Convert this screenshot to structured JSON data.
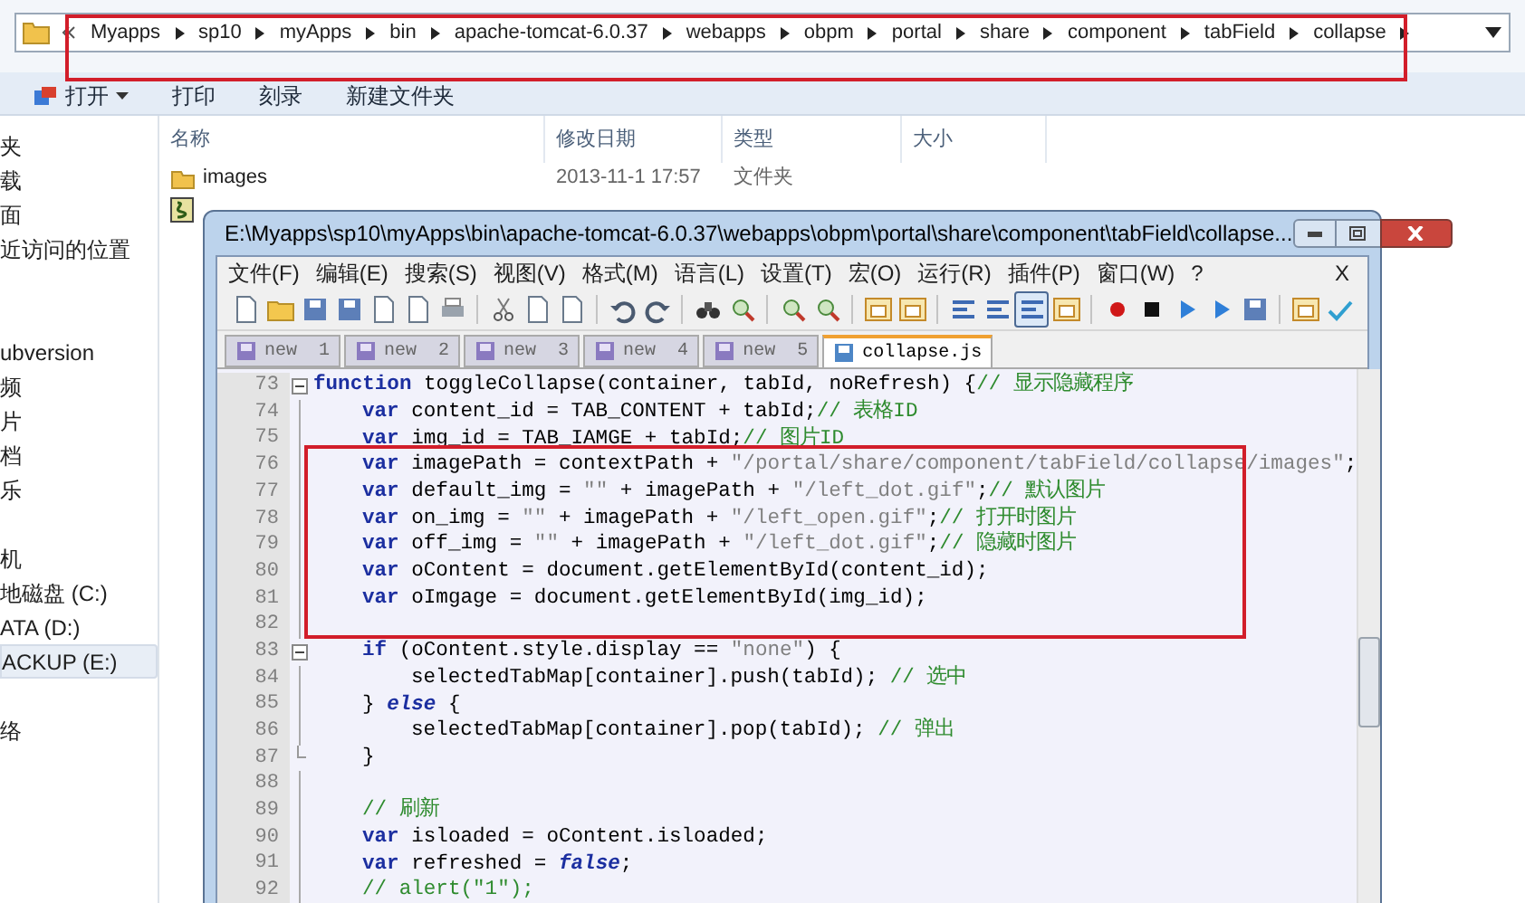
{
  "explorer": {
    "breadcrumb": [
      "Myapps",
      "sp10",
      "myApps",
      "bin",
      "apache-tomcat-6.0.37",
      "webapps",
      "obpm",
      "portal",
      "share",
      "component",
      "tabField",
      "collapse"
    ],
    "toolbar": [
      {
        "label": "打开",
        "dropdown": true
      },
      {
        "label": "打印",
        "dropdown": false
      },
      {
        "label": "刻录",
        "dropdown": false
      },
      {
        "label": "新建文件夹",
        "dropdown": false
      }
    ],
    "nav": [
      [
        {
          "label": "夹",
          "selected": false
        },
        {
          "label": "载",
          "selected": false
        },
        {
          "label": "面",
          "selected": false
        },
        {
          "label": "近访问的位置",
          "selected": false
        }
      ],
      [
        {
          "label": "ubversion",
          "selected": false
        },
        {
          "label": "频",
          "selected": false
        },
        {
          "label": "片",
          "selected": false
        },
        {
          "label": "档",
          "selected": false
        },
        {
          "label": "乐",
          "selected": false
        }
      ],
      [
        {
          "label": "机",
          "selected": false
        },
        {
          "label": "地磁盘 (C:)",
          "selected": false
        },
        {
          "label": "ATA (D:)",
          "selected": false
        },
        {
          "label": "ACKUP (E:)",
          "selected": true
        }
      ],
      [
        {
          "label": "络",
          "selected": false
        }
      ]
    ],
    "columns": [
      "名称",
      "修改日期",
      "类型",
      "大小"
    ],
    "rows": [
      {
        "kind": "folder",
        "name": "images",
        "date": "2013-11-1 17:57",
        "type": "文件夹"
      },
      {
        "kind": "script"
      }
    ]
  },
  "editor": {
    "title": "E:\\Myapps\\sp10\\myApps\\bin\\apache-tomcat-6.0.37\\webapps\\obpm\\portal\\share\\component\\tabField\\collapse...",
    "menu": [
      "文件(F)",
      "编辑(E)",
      "搜索(S)",
      "视图(V)",
      "格式(M)",
      "语言(L)",
      "设置(T)",
      "宏(O)",
      "运行(R)",
      "插件(P)",
      "窗口(W)",
      "?"
    ],
    "close_doc": "X",
    "toolbar": [
      [
        {
          "pressed": false
        },
        {
          "pressed": false
        },
        {
          "pressed": false
        },
        {
          "pressed": false
        },
        {
          "pressed": false
        },
        {
          "pressed": false
        },
        {
          "pressed": false
        }
      ],
      [
        {
          "pressed": false
        },
        {
          "pressed": false
        },
        {
          "pressed": false
        }
      ],
      [
        {
          "pressed": false
        },
        {
          "pressed": false
        }
      ],
      [
        {
          "pressed": false
        },
        {
          "pressed": false
        }
      ],
      [
        {
          "pressed": false
        },
        {
          "pressed": false
        }
      ],
      [
        {
          "pressed": false
        },
        {
          "pressed": false
        }
      ],
      [
        {
          "pressed": false
        },
        {
          "pressed": false
        },
        {
          "pressed": true
        },
        {
          "pressed": false
        }
      ],
      [
        {
          "pressed": false
        },
        {
          "pressed": false
        },
        {
          "pressed": false
        },
        {
          "pressed": false
        },
        {
          "pressed": false
        }
      ],
      [
        {
          "pressed": false
        },
        {
          "pressed": false
        }
      ]
    ],
    "tabs": [
      {
        "label": "new  1",
        "selected": false
      },
      {
        "label": "new  2",
        "selected": false
      },
      {
        "label": "new  3",
        "selected": false
      },
      {
        "label": "new  4",
        "selected": false
      },
      {
        "label": "new  5",
        "selected": false
      },
      {
        "label": "collapse.js",
        "selected": true
      }
    ],
    "lines": [
      {
        "number": "73",
        "kind": "top",
        "fold_start": true,
        "tokens": [
          {
            "kind": "kw",
            "text": "function"
          },
          {
            "kind": "plain",
            "text": " toggleCollapse(container, tabId, noRefresh) {"
          },
          {
            "kind": "comment",
            "text": "// 显示隐藏程序"
          }
        ]
      },
      {
        "number": "74",
        "kind": "body",
        "tokens": [
          {
            "kind": "kw",
            "text": "var"
          },
          {
            "kind": "plain",
            "text": " content_id = TAB_CONTENT + tabId;"
          },
          {
            "kind": "comment",
            "text": "// 表格ID"
          }
        ]
      },
      {
        "number": "75",
        "kind": "body",
        "tokens": [
          {
            "kind": "kw",
            "text": "var"
          },
          {
            "kind": "plain",
            "text": " img_id = TAB_IAMGE + tabId;"
          },
          {
            "kind": "comment",
            "text": "// 图片ID"
          }
        ]
      },
      {
        "number": "76",
        "kind": "body",
        "tokens": [
          {
            "kind": "kw",
            "text": "var"
          },
          {
            "kind": "plain",
            "text": " imagePath = contextPath + "
          },
          {
            "kind": "str",
            "text": "\"/portal/share/component/tabField/collapse/images\""
          },
          {
            "kind": "plain",
            "text": ";"
          }
        ]
      },
      {
        "number": "77",
        "kind": "body",
        "tokens": [
          {
            "kind": "kw",
            "text": "var"
          },
          {
            "kind": "plain",
            "text": " default_img = "
          },
          {
            "kind": "str",
            "text": "\"\""
          },
          {
            "kind": "plain",
            "text": " + imagePath + "
          },
          {
            "kind": "str",
            "text": "\"/left_dot.gif\""
          },
          {
            "kind": "plain",
            "text": ";"
          },
          {
            "kind": "comment",
            "text": "// 默认图片"
          }
        ]
      },
      {
        "number": "78",
        "kind": "body",
        "tokens": [
          {
            "kind": "kw",
            "text": "var"
          },
          {
            "kind": "plain",
            "text": " on_img = "
          },
          {
            "kind": "str",
            "text": "\"\""
          },
          {
            "kind": "plain",
            "text": " + imagePath + "
          },
          {
            "kind": "str",
            "text": "\"/left_open.gif\""
          },
          {
            "kind": "plain",
            "text": ";"
          },
          {
            "kind": "comment",
            "text": "// 打开时图片"
          }
        ]
      },
      {
        "number": "79",
        "kind": "body",
        "tokens": [
          {
            "kind": "kw",
            "text": "var"
          },
          {
            "kind": "plain",
            "text": " off_img = "
          },
          {
            "kind": "str",
            "text": "\"\""
          },
          {
            "kind": "plain",
            "text": " + imagePath + "
          },
          {
            "kind": "str",
            "text": "\"/left_dot.gif\""
          },
          {
            "kind": "plain",
            "text": ";"
          },
          {
            "kind": "comment",
            "text": "// 隐藏时图片"
          }
        ]
      },
      {
        "number": "80",
        "kind": "body",
        "tokens": [
          {
            "kind": "kw",
            "text": "var"
          },
          {
            "kind": "plain",
            "text": " oContent = document.getElementById(content_id);"
          }
        ]
      },
      {
        "number": "81",
        "kind": "body",
        "tokens": [
          {
            "kind": "kw",
            "text": "var"
          },
          {
            "kind": "plain",
            "text": " oImgage = document.getElementById(img_id);"
          }
        ]
      },
      {
        "number": "82"
      },
      {
        "number": "83",
        "kind": "body",
        "fold_start": true,
        "tokens": [
          {
            "kind": "kw",
            "text": "if"
          },
          {
            "kind": "plain",
            "text": " (oContent.style.display == "
          },
          {
            "kind": "str",
            "text": "\"none\""
          },
          {
            "kind": "plain",
            "text": ") {"
          }
        ]
      },
      {
        "number": "84",
        "kind": "nested",
        "tokens": [
          {
            "kind": "plain",
            "text": "selectedTabMap[container].push(tabId); "
          },
          {
            "kind": "comment",
            "text": "// 选中"
          }
        ]
      },
      {
        "number": "85",
        "kind": "body",
        "tokens": [
          {
            "kind": "plain",
            "text": "} "
          },
          {
            "kind": "kwi",
            "text": "else"
          },
          {
            "kind": "plain",
            "text": " {"
          }
        ]
      },
      {
        "number": "86",
        "kind": "nested",
        "tokens": [
          {
            "kind": "plain",
            "text": "selectedTabMap[container].pop(tabId); "
          },
          {
            "kind": "comment",
            "text": "// 弹出"
          }
        ]
      },
      {
        "number": "87",
        "kind": "body",
        "fold_end": true,
        "tokens": [
          {
            "kind": "plain",
            "text": "}"
          }
        ]
      },
      {
        "number": "88"
      },
      {
        "number": "89",
        "kind": "body",
        "tokens": [
          {
            "kind": "comment",
            "text": "// 刷新"
          }
        ]
      },
      {
        "number": "90",
        "kind": "body",
        "tokens": [
          {
            "kind": "kw",
            "text": "var"
          },
          {
            "kind": "plain",
            "text": " isloaded = oContent.isloaded;"
          }
        ]
      },
      {
        "number": "91",
        "kind": "body",
        "tokens": [
          {
            "kind": "kw",
            "text": "var"
          },
          {
            "kind": "plain",
            "text": " refreshed = "
          },
          {
            "kind": "kwi",
            "text": "false"
          },
          {
            "kind": "plain",
            "text": ";"
          }
        ]
      },
      {
        "number": "92",
        "kind": "body",
        "tokens": [
          {
            "kind": "comment",
            "text": "// alert(\"1\");"
          }
        ]
      }
    ]
  }
}
